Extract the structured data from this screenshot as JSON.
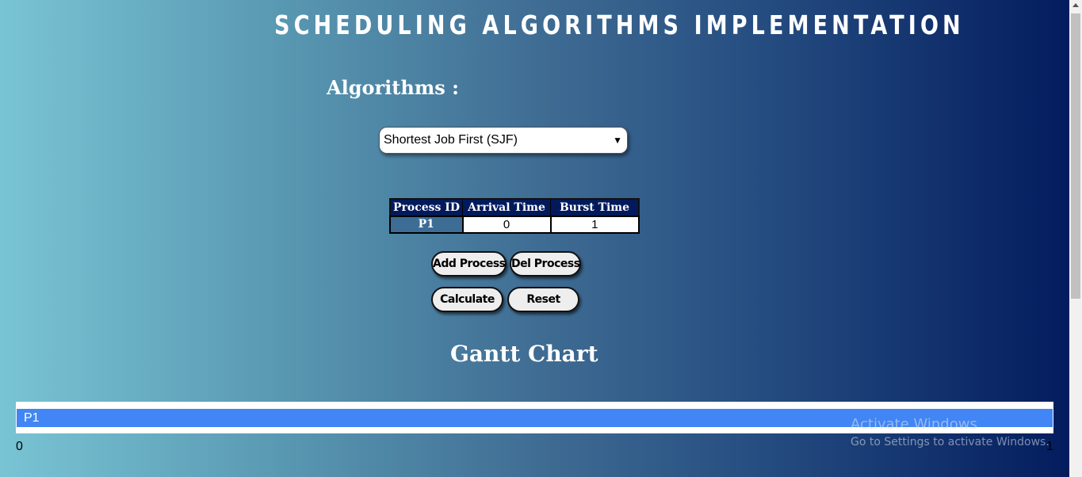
{
  "header": {
    "title": "SCHEDULING ALGORITHMS IMPLEMENTATION"
  },
  "algorithms": {
    "label": "Algorithms :",
    "selected": "Shortest Job First (SJF)"
  },
  "process_table": {
    "columns": [
      "Process ID",
      "Arrival Time",
      "Burst Time"
    ],
    "rows": [
      {
        "pid": "P1",
        "arrival": "0",
        "burst": "1"
      }
    ]
  },
  "buttons": {
    "add_process": "Add Process",
    "del_process": "Del Process",
    "calculate": "Calculate",
    "reset": "Reset"
  },
  "gantt": {
    "title": "Gantt Chart",
    "bars": [
      {
        "label": "P1",
        "start": 0,
        "end": 1
      }
    ],
    "ticks": [
      "0",
      "1"
    ]
  },
  "watermark": {
    "line1": "Activate Windows",
    "line2": "Go to Settings to activate Windows."
  },
  "colors": {
    "gantt_bar": "#4285f4",
    "header_bg": "#021a5c"
  }
}
